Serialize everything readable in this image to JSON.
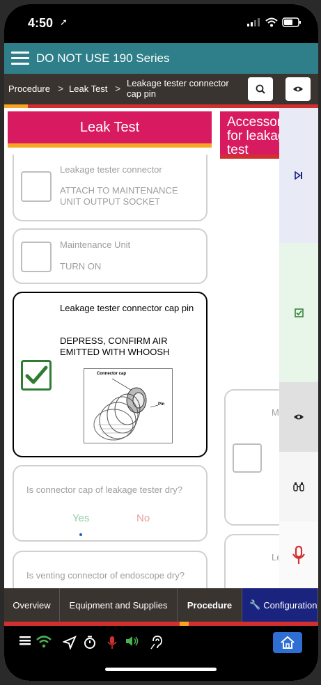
{
  "status_bar": {
    "time": "4:50"
  },
  "header": {
    "title": "DO NOT USE 190 Series"
  },
  "breadcrumb": {
    "items": [
      "Procedure",
      "Leak Test",
      "Leakage tester connector cap pin"
    ],
    "separator": ">"
  },
  "columns": {
    "main_title": "Leak Test",
    "secondary_title": "Accessories for leakage test"
  },
  "steps": [
    {
      "title": "Leakage tester connector",
      "instruction": "ATTACH TO MAINTENANCE UNIT OUTPUT SOCKET"
    },
    {
      "title": "Maintenance Unit",
      "instruction": "TURN ON"
    },
    {
      "title": "Leakage tester connector cap pin",
      "instruction": "DEPRESS, CONFIRM AIR EMITTED WITH WHOOSH",
      "checked": true,
      "diagram": {
        "label_cap": "Connector cap",
        "label_pin": "Pin"
      }
    }
  ],
  "questions": [
    {
      "text": "Is connector cap of leakage tester dry?",
      "yes": "Yes",
      "no": "No"
    },
    {
      "text": "Is venting connector of endoscope dry?"
    }
  ],
  "right_cards": [
    {
      "partial_text": "M"
    },
    {
      "partial_text": "Le"
    }
  ],
  "rail": {
    "icons": [
      "skip-icon",
      "checkbox-icon",
      "eye-icon",
      "binoculars-icon",
      "microphone-icon"
    ],
    "colors": [
      "#e8eaf6",
      "#e8f5e9",
      "#e0e0e0",
      "#f5f5f5",
      "#fafafa"
    ]
  },
  "tabs": [
    "Overview",
    "Equipment and Supplies",
    "Procedure",
    "Configuration"
  ],
  "active_tab": "Procedure",
  "colors": {
    "accent": "#2e7f8a",
    "section": "#d81b60",
    "progress": "#d32f2f",
    "highlight": "#f5a623",
    "check": "#2e7d32"
  }
}
